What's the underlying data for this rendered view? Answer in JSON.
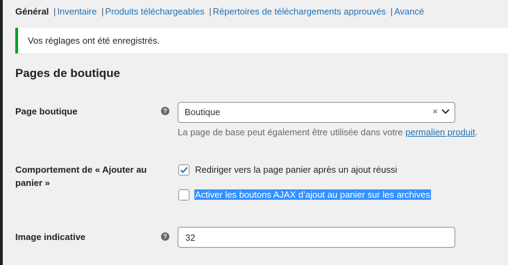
{
  "tabs": [
    {
      "label": "Général",
      "current": true
    },
    {
      "label": "Inventaire"
    },
    {
      "label": "Produits téléchargeables"
    },
    {
      "label": "Répertoires de téléchargements approuvés"
    },
    {
      "label": "Avancé"
    }
  ],
  "tab_separator": "|",
  "notice": {
    "text": "Vos réglages ont été enregistrés."
  },
  "section": {
    "title": "Pages de boutique"
  },
  "shop_page": {
    "label": "Page boutique",
    "help": "?",
    "select_value": "Boutique",
    "clear_symbol": "×",
    "description_prefix": "La page de base peut également être utilisée dans votre ",
    "description_link": "permalien produit",
    "description_suffix": "."
  },
  "add_to_cart": {
    "label_line1": "Comportement de « Ajouter au",
    "label_line2": "panier »",
    "option1": {
      "label": "Rediriger vers la page panier après un ajout réussi",
      "checked": true
    },
    "option2": {
      "label": "Activer les boutons AJAX d’ajout au panier sur les archives",
      "checked": false
    }
  },
  "placeholder_image": {
    "label": "Image indicative",
    "help": "?",
    "value": "32"
  },
  "colors": {
    "accent": "#2271b1",
    "success": "#00a32a",
    "selection": "#3390ff"
  }
}
